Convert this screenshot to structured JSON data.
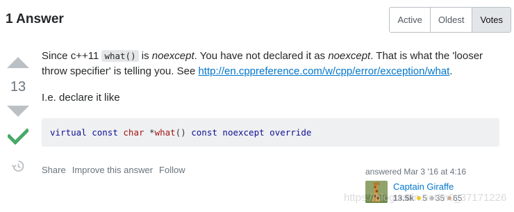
{
  "header": {
    "answers_count": "1 Answer",
    "tabs": [
      {
        "label": "Active"
      },
      {
        "label": "Oldest"
      },
      {
        "label": "Votes"
      }
    ]
  },
  "votes": {
    "count": "13"
  },
  "post": {
    "p1_a": "Since c++11 ",
    "p1_code": "what()",
    "p1_b": " is ",
    "p1_em1": "noexcept",
    "p1_c": ". You have not declared it as ",
    "p1_em2": "noexcept",
    "p1_d": ". That is what the 'looser throw specifier' is telling you. See ",
    "p1_link": "http://en.cppreference.com/w/cpp/error/exception/what",
    "p1_e": ".",
    "p2": "I.e. declare it like"
  },
  "code_block": {
    "t1": "virtual",
    "t2": " ",
    "t3": "const",
    "t4": " ",
    "t5": "char",
    "t6": " *",
    "t7": "what",
    "t8": "() ",
    "t9": "const",
    "t10": " ",
    "t11": "noexcept",
    "t12": " ",
    "t13": "override"
  },
  "post_menu": {
    "share": "Share",
    "improve": "Improve this answer",
    "follow": "Follow"
  },
  "user": {
    "action_time": "answered Mar 3 '16 at 4:16",
    "name": "Captain Giraffe",
    "reputation": "13.5k",
    "gold": "5",
    "silver": "35",
    "bronze": "65"
  },
  "watermark": "https://blog.csdn.net/m0_37171226",
  "colors": {
    "accent": "#0077cc",
    "accepted": "#48a868",
    "arrow": "#bbc0c4"
  }
}
